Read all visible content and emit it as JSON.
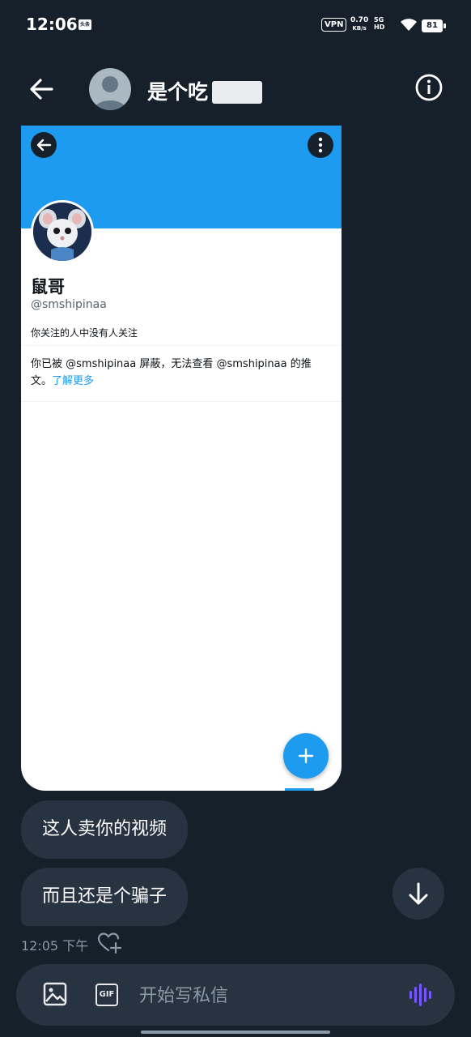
{
  "status_bar": {
    "time": "12:06",
    "badge": "头条",
    "vpn": "VPN",
    "net_speed_value": "0.70",
    "net_speed_unit": "KB/s",
    "net_type": "5G HD",
    "battery": "81"
  },
  "header": {
    "contact_name": "是个吃",
    "back_icon": "back-arrow-icon",
    "info_icon": "info-icon"
  },
  "shared_screenshot": {
    "profile_name": "鼠哥",
    "profile_handle": "@smshipinaa",
    "follow_info": "你关注的人中没有人关注",
    "blocked_notice": "你已被 @smshipinaa 屏蔽，无法查看 @smshipinaa 的推文。",
    "learn_more": "了解更多",
    "colors": {
      "banner": "#1d9bf0",
      "accent": "#1d9bf0"
    }
  },
  "messages": [
    {
      "text": "这人卖你的视频"
    },
    {
      "text": "而且还是个骗子"
    }
  ],
  "message_meta": {
    "timestamp": "12:05 下午"
  },
  "composer": {
    "placeholder": "开始写私信",
    "gif_label": "GIF"
  },
  "colors": {
    "background": "#15202b",
    "bubble": "#273340",
    "voice_accent": "#7856ff"
  }
}
